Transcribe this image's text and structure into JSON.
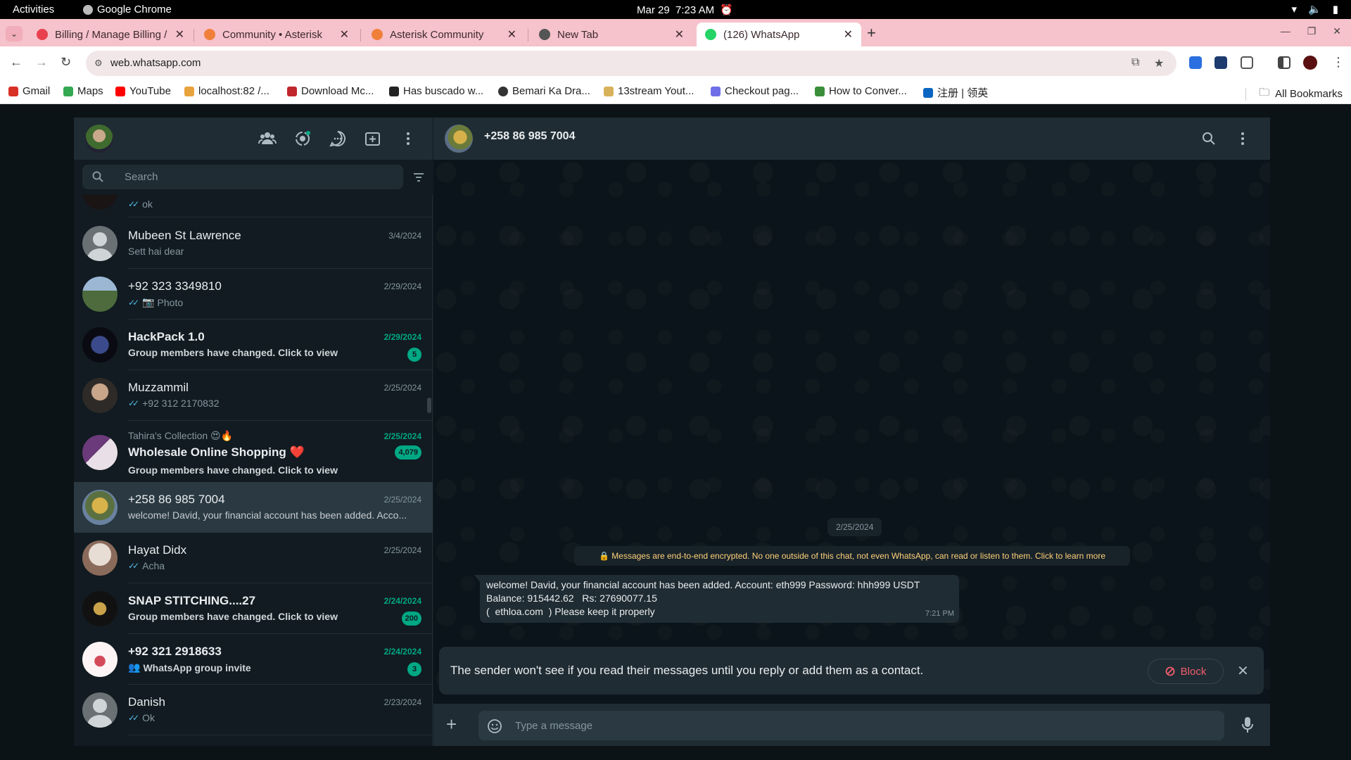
{
  "os": {
    "activities": "Activities",
    "app_name": "Google Chrome",
    "date": "Mar 29",
    "time": "7:23 AM"
  },
  "tabs": [
    {
      "title": "Billing / Manage Billing /",
      "icon": "billing-favicon",
      "color": "#e8404f"
    },
    {
      "title": "Community • Asterisk",
      "icon": "asterisk-favicon",
      "color": "#f07f3a"
    },
    {
      "title": "Asterisk Community",
      "icon": "asterisk-favicon",
      "color": "#f07f3a"
    },
    {
      "title": "New Tab",
      "icon": "chrome-favicon",
      "color": "#555555"
    },
    {
      "title": "(126) WhatsApp",
      "icon": "whatsapp-favicon",
      "color": "#25d366",
      "active": true
    }
  ],
  "address": {
    "url": "web.whatsapp.com"
  },
  "bookmarks": [
    {
      "label": "Gmail",
      "color": "#d93025"
    },
    {
      "label": "Maps",
      "color": "#34a853"
    },
    {
      "label": "YouTube",
      "color": "#ff0000"
    },
    {
      "label": "localhost:82 /...",
      "color": "#e8a33d"
    },
    {
      "label": "Download Mc...",
      "color": "#c0262d"
    },
    {
      "label": "Has buscado w...",
      "color": "#222222"
    },
    {
      "label": "Bemari Ka Dra...",
      "color": "#333333"
    },
    {
      "label": "13stream Yout...",
      "color": "#d8b25a"
    },
    {
      "label": "Checkout pag...",
      "color": "#6e6ee8"
    },
    {
      "label": "How to Conver...",
      "color": "#3a8e3a"
    },
    {
      "label": "注册 | 领英",
      "color": "#0a66c2"
    }
  ],
  "all_bookmarks": "All Bookmarks",
  "whatsapp": {
    "search_placeholder": "Search",
    "chats": [
      {
        "name": "",
        "preview": "ok",
        "date": "",
        "ticks": true,
        "avatar": "dark"
      },
      {
        "name": "Mubeen St Lawrence",
        "preview": "Sett hai dear",
        "date": "3/4/2024",
        "ticks": false,
        "avatar": "default"
      },
      {
        "name": "+92 323 3349810",
        "preview": "Photo",
        "date": "2/29/2024",
        "ticks": true,
        "photo_icon": true,
        "avatar": "landscape"
      },
      {
        "name": "HackPack 1.0",
        "preview": "Group members have changed. Click to view",
        "date": "2/29/2024",
        "unread": "5",
        "avatar": "hackpack"
      },
      {
        "name": "Muzzammil",
        "preview": "+92 312 2170832",
        "date": "2/25/2024",
        "ticks": true,
        "avatar": "person"
      },
      {
        "group_label": "Tahira's Collection 😍🔥",
        "name": "Wholesale Online Shopping ❤️",
        "preview": "Group members have changed. Click to view",
        "date": "2/25/2024",
        "unread": "4,079",
        "avatar": "tahira"
      },
      {
        "name": "+258 86 985 7004",
        "preview": "welcome! David, your financial account has been added. Acco...",
        "date": "2/25/2024",
        "selected": true,
        "avatar": "yellow"
      },
      {
        "name": "Hayat Didx",
        "preview": "Acha",
        "date": "2/25/2024",
        "ticks": true,
        "avatar": "hayat"
      },
      {
        "name": "SNAP STITCHING....27",
        "preview": "Group members have changed. Click to view",
        "date": "2/24/2024",
        "unread": "200",
        "avatar": "snap"
      },
      {
        "name": "+92 321 2918633",
        "preview": "WhatsApp group invite",
        "date": "2/24/2024",
        "unread": "3",
        "group_icon": true,
        "avatar": "dress"
      },
      {
        "name": "Danish",
        "preview": "Ok",
        "date": "2/23/2024",
        "ticks": true,
        "avatar": "default"
      }
    ],
    "chat": {
      "contact": "+258 86 985 7004",
      "date_chip": "2/25/2024",
      "encryption_note": "Messages are end-to-end encrypted. No one outside of this chat, not even WhatsApp, can read or listen to them. Click to learn more",
      "message_lines": [
        "welcome! David, your financial account has been added. Account: eth999 Password: hhh999 USDT",
        "Balance: 915442.62   Rs: 27690077.15",
        "(  ethloa.com  ) Please keep it properly"
      ],
      "message_time": "7:21 PM",
      "notice": "The sender won't see if you read their messages until you reply or add them as a contact.",
      "block_label": "Block",
      "input_placeholder": "Type a message"
    }
  }
}
